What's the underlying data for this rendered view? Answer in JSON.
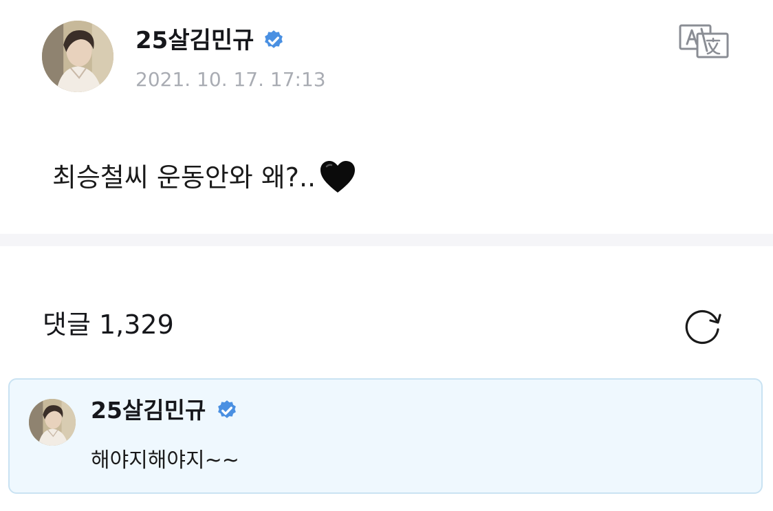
{
  "post": {
    "author_name": "25살김민규",
    "verified_icon": "verified-badge-icon",
    "timestamp": "2021. 10. 17. 17:13",
    "translate_icon": "translate-icon",
    "body_text": "최승철씨 운동안와 왜?..",
    "body_emoji_icon": "black-heart-icon"
  },
  "comments": {
    "header": "댓글 1,329",
    "refresh_icon": "refresh-icon",
    "items": [
      {
        "author_name": "25살김민규",
        "verified": true,
        "text": "해야지해야지~~"
      }
    ]
  },
  "colors": {
    "verified": "#4a90e2",
    "timestamp": "#a9acb3",
    "comment_card_bg": "#eff8fe",
    "comment_card_border": "#c9e2f2",
    "divider": "#f5f5f8"
  }
}
